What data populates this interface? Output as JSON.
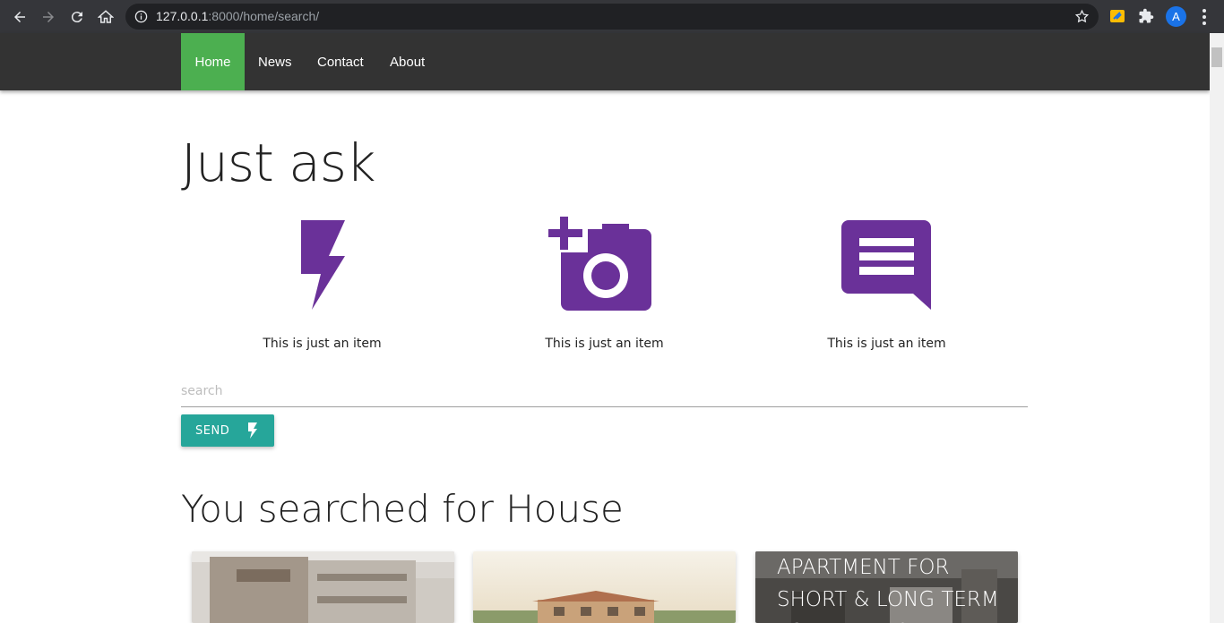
{
  "browser": {
    "url_host": "127.0.0.1",
    "url_path": ":8000/home/search/",
    "avatar_letter": "A"
  },
  "nav": {
    "items": [
      {
        "label": "Home",
        "active": true
      },
      {
        "label": "News",
        "active": false
      },
      {
        "label": "Contact",
        "active": false
      },
      {
        "label": "About",
        "active": false
      }
    ]
  },
  "hero": {
    "title": "Just ask"
  },
  "features": [
    {
      "icon": "flash-icon",
      "text": "This is just an item"
    },
    {
      "icon": "add-a-photo-icon",
      "text": "This is just an item"
    },
    {
      "icon": "message-icon",
      "text": "This is just an item"
    }
  ],
  "search": {
    "placeholder": "search",
    "value": ""
  },
  "send_button": {
    "label": "SEND",
    "icon": "flash-icon"
  },
  "results": {
    "title": "You searched for House",
    "cards": [
      {
        "image": "house-photo-1",
        "title": ""
      },
      {
        "image": "house-photo-2",
        "title": ""
      },
      {
        "image": "apartment-interior-photo",
        "title": "APARTMENT FOR SHORT & LONG TERM FOR EXPAT &"
      }
    ]
  },
  "colors": {
    "nav_bg": "#333333",
    "nav_active": "#4caf50",
    "icon_purple": "#6a3199",
    "button_teal": "#26a69a"
  }
}
